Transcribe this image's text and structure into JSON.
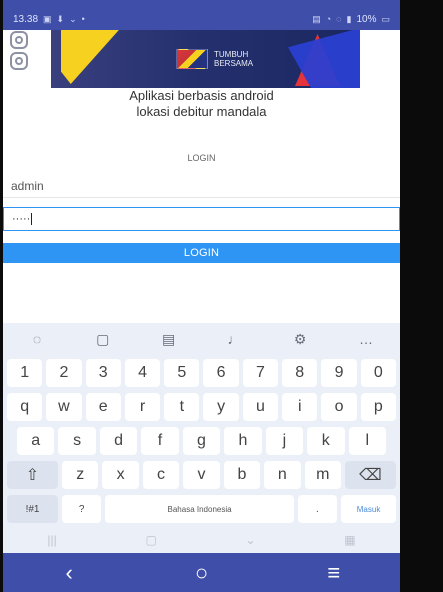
{
  "status": {
    "time": "13.38",
    "battery": "10%"
  },
  "app": {
    "title_line1": "Aplikasi berbasis android",
    "title_line2": "lokasi debitur mandala",
    "login_title": "LOGIN",
    "username": "admin",
    "password_mask": "·····",
    "login_button": "LOGIN"
  },
  "banner": {
    "brand_line1": "TUMBUH",
    "brand_line2": "BERSAMA"
  },
  "keyboard": {
    "toolbar": [
      "emoji-icon",
      "clipboard-icon",
      "keyboard-icon",
      "mic-icon",
      "settings-icon",
      "more-icon"
    ],
    "row1": [
      "1",
      "2",
      "3",
      "4",
      "5",
      "6",
      "7",
      "8",
      "9",
      "0"
    ],
    "row2": [
      "q",
      "w",
      "e",
      "r",
      "t",
      "y",
      "u",
      "i",
      "o",
      "p"
    ],
    "row3": [
      "a",
      "s",
      "d",
      "f",
      "g",
      "h",
      "j",
      "k",
      "l"
    ],
    "row4": [
      "z",
      "x",
      "c",
      "v",
      "b",
      "n",
      "m"
    ],
    "row5": {
      "symbols": "!#1",
      "question": "?",
      "space": "Bahasa Indonesia",
      "dot": ".",
      "enter": "Masuk"
    }
  },
  "colors": {
    "primary": "#2f95f5",
    "status_bar": "#3f4ea8",
    "keyboard_bg": "#ebeff7"
  }
}
